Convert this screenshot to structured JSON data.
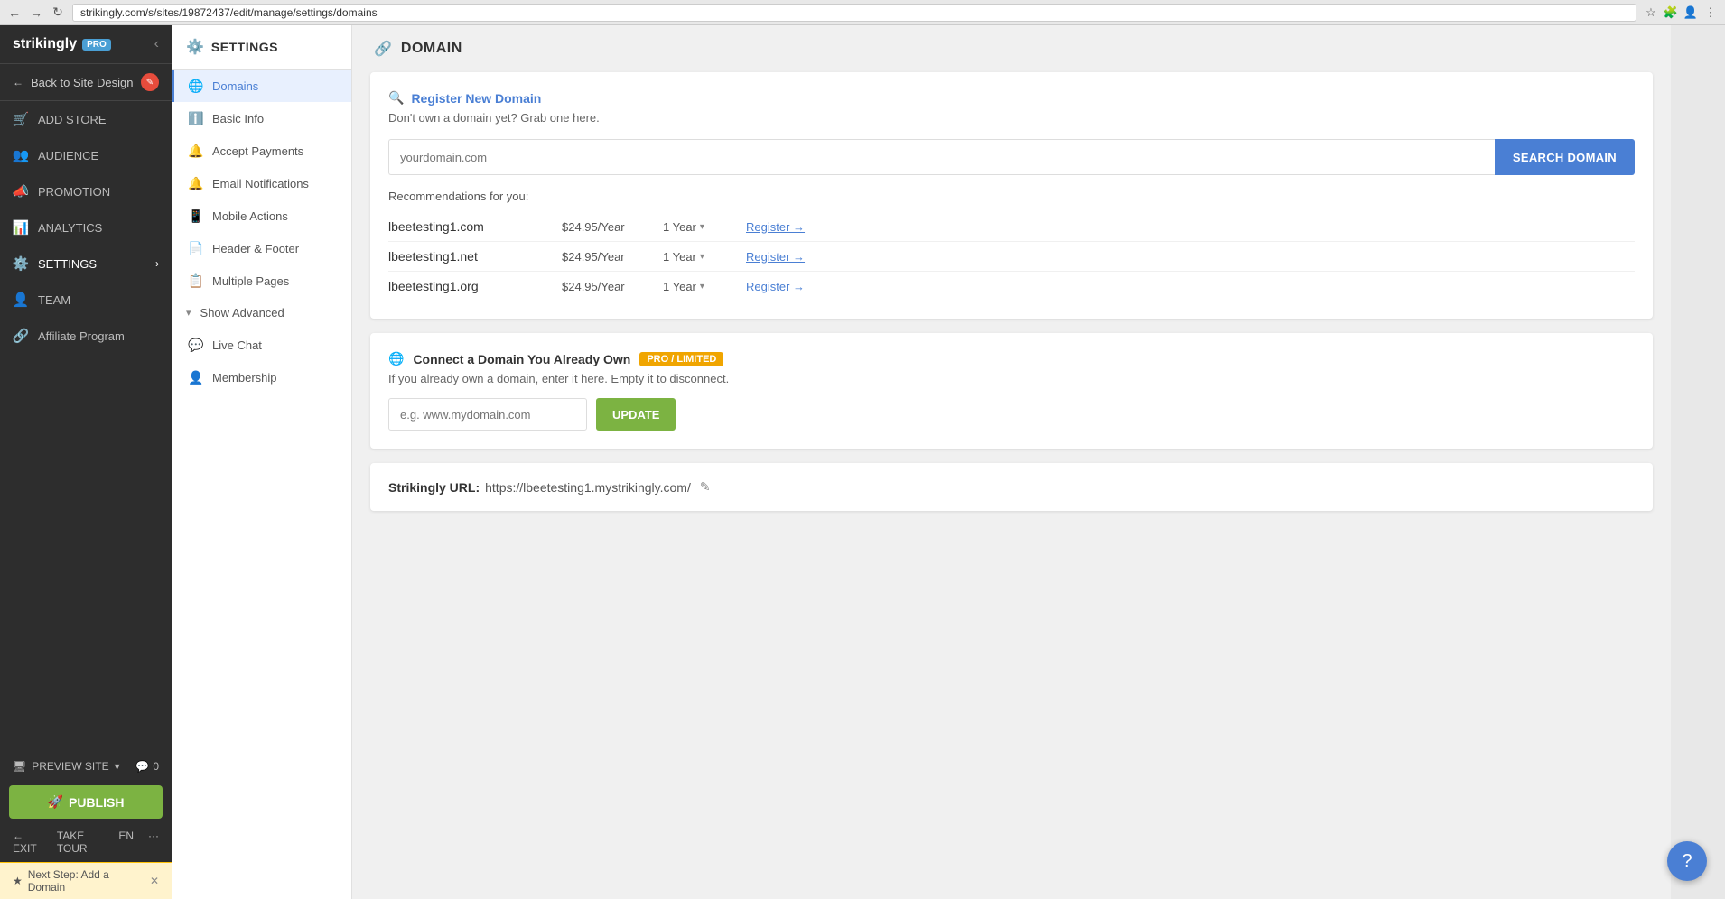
{
  "browser": {
    "url": "strikingly.com/s/sites/19872437/edit/manage/settings/domains"
  },
  "sidebar": {
    "logo": "strikingly",
    "pro_badge": "PRO",
    "back_label": "Back to Site Design",
    "nav_items": [
      {
        "id": "add-store",
        "label": "ADD STORE",
        "icon": "🛒"
      },
      {
        "id": "audience",
        "label": "AUDIENCE",
        "icon": "👥"
      },
      {
        "id": "promotion",
        "label": "PROMOTION",
        "icon": "📣"
      },
      {
        "id": "analytics",
        "label": "ANALYTICS",
        "icon": "📊"
      },
      {
        "id": "settings",
        "label": "SETTINGS",
        "icon": "⚙️",
        "active": true,
        "has_arrow": true
      },
      {
        "id": "team",
        "label": "TEAM",
        "icon": "👤"
      },
      {
        "id": "affiliate",
        "label": "Affiliate Program",
        "icon": "🔗"
      }
    ],
    "preview_label": "PREVIEW SITE",
    "publish_label": "PUBLISH",
    "bottom_actions": [
      "EXIT",
      "TAKE TOUR",
      "EN",
      "···"
    ],
    "next_step_label": "Next Step: Add a Domain"
  },
  "settings": {
    "header_title": "SETTINGS",
    "nav_items": [
      {
        "id": "domains",
        "label": "Domains",
        "icon": "🌐",
        "active": true
      },
      {
        "id": "basic-info",
        "label": "Basic Info",
        "icon": "ℹ️"
      },
      {
        "id": "accept-payments",
        "label": "Accept Payments",
        "icon": "🔔"
      },
      {
        "id": "email-notifications",
        "label": "Email Notifications",
        "icon": "🔔"
      },
      {
        "id": "mobile-actions",
        "label": "Mobile Actions",
        "icon": "📱"
      },
      {
        "id": "header-footer",
        "label": "Header & Footer",
        "icon": "📄"
      },
      {
        "id": "multiple-pages",
        "label": "Multiple Pages",
        "icon": "📋"
      }
    ],
    "show_advanced_label": "Show Advanced",
    "advanced_items": [
      {
        "id": "live-chat",
        "label": "Live Chat",
        "icon": "💬"
      },
      {
        "id": "membership",
        "label": "Membership",
        "icon": "👤"
      }
    ]
  },
  "domain": {
    "header_title": "DOMAIN",
    "register_section": {
      "title": "Register New Domain",
      "subtitle": "Don't own a domain yet? Grab one here.",
      "input_placeholder": "yourdomain.com",
      "search_btn_label": "SEARCH DOMAIN",
      "recommendations_label": "Recommendations for you:",
      "items": [
        {
          "domain": "lbeetesting1.com",
          "price": "$24.95/Year",
          "duration": "1 Year",
          "register_label": "Register →"
        },
        {
          "domain": "lbeetesting1.net",
          "price": "$24.95/Year",
          "duration": "1 Year",
          "register_label": "Register →"
        },
        {
          "domain": "lbeetesting1.org",
          "price": "$24.95/Year",
          "duration": "1 Year",
          "register_label": "Register →"
        }
      ]
    },
    "connect_section": {
      "title": "Connect a Domain You Already Own",
      "badge": "PRO / LIMITED",
      "subtitle": "If you already own a domain, enter it here. Empty it to disconnect.",
      "input_placeholder": "e.g. www.mydomain.com",
      "update_btn_label": "UPDATE"
    },
    "strikingly_url": {
      "label": "Strikingly URL:",
      "value": "https://lbeetesting1.mystrikingly.com/"
    }
  }
}
